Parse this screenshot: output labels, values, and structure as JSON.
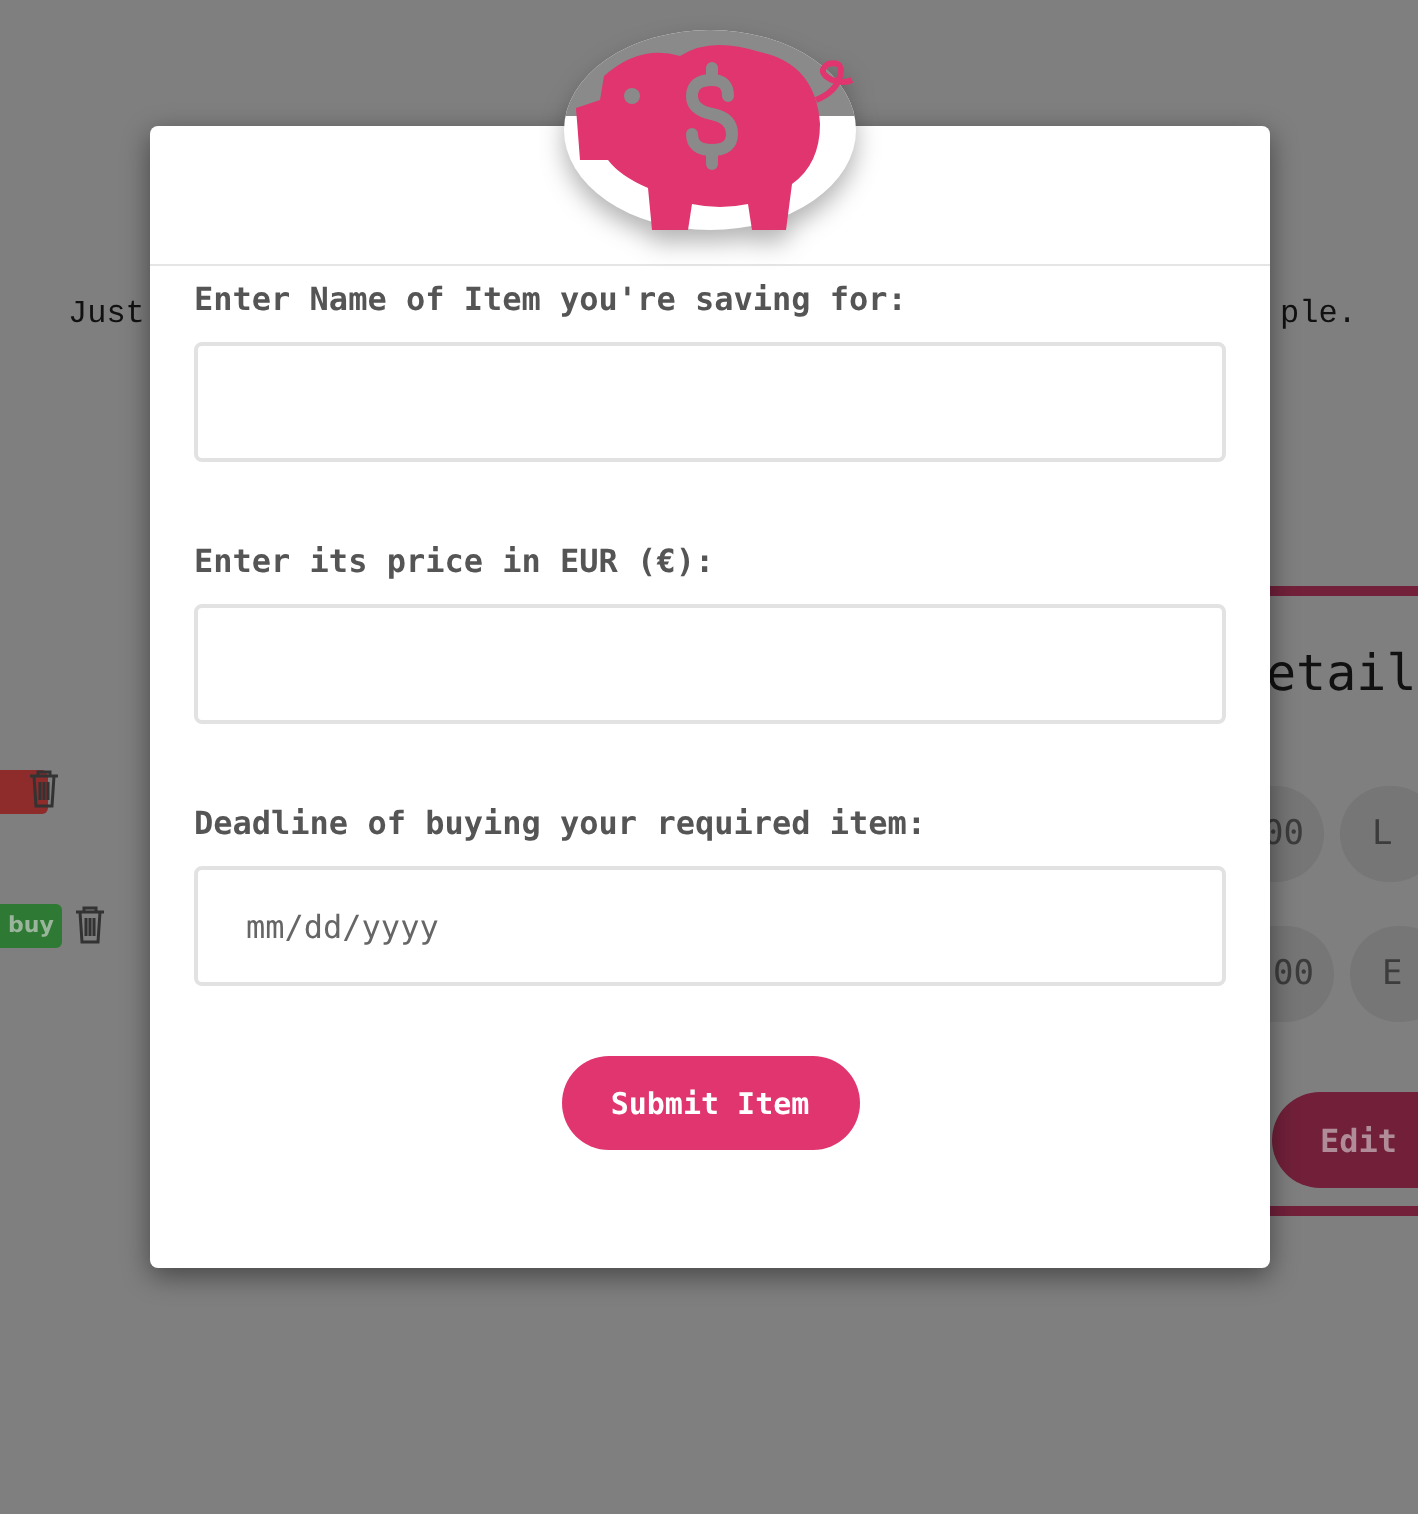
{
  "background_page": {
    "intro_text_left": "Just",
    "intro_text_right": "ple.",
    "details_title": "etail",
    "badges": [
      {
        "color": "#8e2b2b"
      },
      {
        "label": "buy",
        "color": "#2e7a34"
      }
    ],
    "rows": [
      {
        "pill_1": "00",
        "pill_2": "L"
      },
      {
        "pill_1": "00",
        "pill_2": "E"
      }
    ],
    "edit_button": "Edit"
  },
  "modal": {
    "fields": [
      {
        "label": "Enter Name of Item you're saving for:"
      },
      {
        "label": "Enter its price in EUR (€):"
      },
      {
        "label": "Deadline of buying your required item:",
        "placeholder": "mm/dd/yyyy"
      }
    ],
    "submit_button": "Submit Item"
  }
}
